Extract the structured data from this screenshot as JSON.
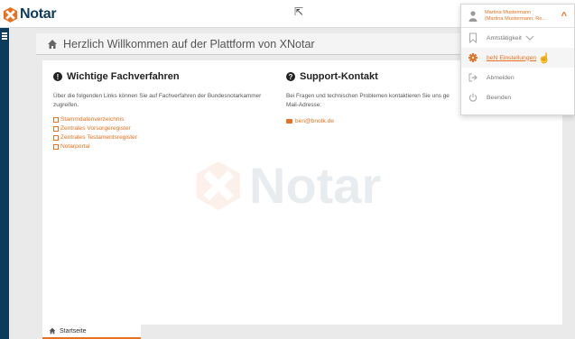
{
  "brand": {
    "name": "Notar",
    "accent": "#e8711f",
    "primary": "#0d3b5e"
  },
  "page": {
    "title": "Herzlich Willkommen auf der Plattform von XNotar",
    "home_icon": "home-icon"
  },
  "left_column": {
    "heading": "Wichtige Fachverfahren",
    "text": "Über die folgenden Links können Sie auf Fachverfahren der Bundesnotarkammer zugreifen.",
    "links": [
      "Stammdatenverzeichnis",
      "Zentrales Vorsorgeregister",
      "Zentrales Testamentsregister",
      "Notarportal"
    ]
  },
  "right_column": {
    "heading": "Support-Kontakt",
    "text": "Bei Fragen und technischen Problemen kontaktieren Sie uns ge",
    "text2": "Mail-Adresse:",
    "email": "ben@bnotk.de"
  },
  "watermark": {
    "text": "Notar"
  },
  "bottom_tab": {
    "label": "Startseite"
  },
  "user_menu": {
    "name_line1": "Martina Mustermann",
    "name_line2": "(Martina Mustermann, Re...",
    "items": [
      {
        "label": "Amtstätigkeit",
        "icon": "bookmark-icon",
        "suffix": "chevron-down-icon"
      },
      {
        "label": "beN Einstellungen",
        "icon": "gear-icon",
        "active": true
      },
      {
        "label": "Abmelden",
        "icon": "sign-out-icon"
      },
      {
        "label": "Beenden",
        "icon": "power-icon"
      }
    ]
  }
}
